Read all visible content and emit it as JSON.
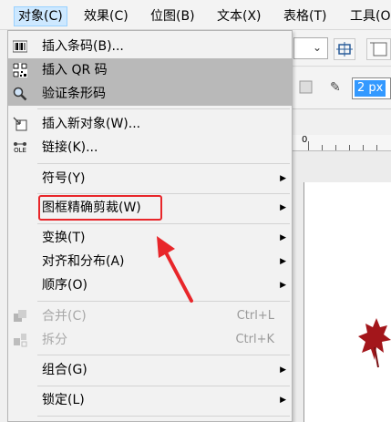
{
  "menubar": {
    "items": [
      "对象(C)",
      "效果(C)",
      "位图(B)",
      "文本(X)",
      "表格(T)",
      "工具(O"
    ]
  },
  "background": {
    "outline_width": "2 px",
    "ruler_zero": "0"
  },
  "menu": {
    "items": [
      {
        "label": "插入条码(B)...",
        "icon": "barcode-icon"
      },
      {
        "label": "插入 QR 码",
        "icon": "qr-code-icon",
        "highlighted": true
      },
      {
        "label": "验证条形码",
        "icon": "magnifier-icon",
        "highlighted": true
      },
      {
        "label": "插入新对象(W)...",
        "icon": "insert-object-icon"
      },
      {
        "label": "链接(K)...",
        "icon": "ole-icon",
        "icon_text": "OLE"
      },
      {
        "label": "符号(Y)",
        "submenu": true
      },
      {
        "label": "图框精确剪裁(W)",
        "submenu": true,
        "annotated": true
      },
      {
        "label": "变换(T)",
        "submenu": true
      },
      {
        "label": "对齐和分布(A)",
        "submenu": true
      },
      {
        "label": "顺序(O)",
        "submenu": true
      },
      {
        "label": "合并(C)",
        "shortcut": "Ctrl+L",
        "disabled": true,
        "icon": "combine-icon"
      },
      {
        "label": "拆分",
        "shortcut": "Ctrl+K",
        "disabled": true,
        "icon": "break-apart-icon"
      },
      {
        "label": "组合(G)",
        "submenu": true
      },
      {
        "label": "锁定(L)",
        "submenu": true
      }
    ]
  },
  "colors": {
    "annotation_red": "#e8262a",
    "highlight": "#b9b9b9",
    "selection_blue": "#3399ff"
  }
}
